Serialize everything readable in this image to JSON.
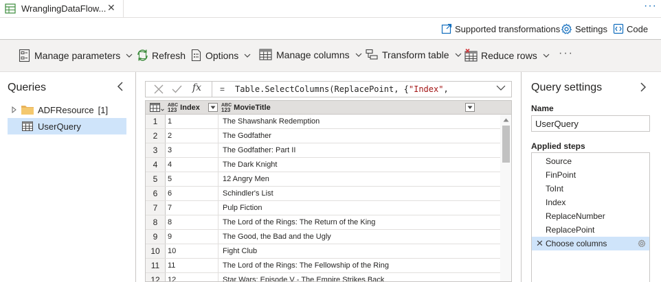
{
  "tab": {
    "title": "WranglingDataFlow...",
    "close": "✕"
  },
  "top_links": {
    "supported": "Supported transformations",
    "settings": "Settings",
    "code": "Code"
  },
  "toolbar": {
    "manage_parameters": "Manage parameters",
    "refresh": "Refresh",
    "options": "Options",
    "manage_columns": "Manage columns",
    "transform_table": "Transform table",
    "reduce_rows": "Reduce rows",
    "more": "···"
  },
  "queries": {
    "title": "Queries",
    "items": [
      {
        "label": "ADFResource",
        "count": "[1]"
      },
      {
        "label": "UserQuery"
      }
    ]
  },
  "formula": {
    "eq": "=",
    "text_prefix": "Table.SelectColumns(ReplacePoint, {",
    "text_string": "\"Index\"",
    "text_suffix": ","
  },
  "grid": {
    "type_badge_top": "ABC",
    "type_badge_bottom": "123",
    "columns": [
      "Index",
      "MovieTitle"
    ],
    "rows": [
      {
        "n": "1",
        "index": "1",
        "title": "The Shawshank Redemption"
      },
      {
        "n": "2",
        "index": "2",
        "title": "The Godfather"
      },
      {
        "n": "3",
        "index": "3",
        "title": "The Godfather: Part II"
      },
      {
        "n": "4",
        "index": "4",
        "title": "The Dark Knight"
      },
      {
        "n": "5",
        "index": "5",
        "title": "12 Angry Men"
      },
      {
        "n": "6",
        "index": "6",
        "title": "Schindler's List"
      },
      {
        "n": "7",
        "index": "7",
        "title": "Pulp Fiction"
      },
      {
        "n": "8",
        "index": "8",
        "title": "The Lord of the Rings: The Return of the King"
      },
      {
        "n": "9",
        "index": "9",
        "title": "The Good, the Bad and the Ugly"
      },
      {
        "n": "10",
        "index": "10",
        "title": "Fight Club"
      },
      {
        "n": "11",
        "index": "11",
        "title": "The Lord of the Rings: The Fellowship of the Ring"
      },
      {
        "n": "12",
        "index": "12",
        "title": "Star Wars: Episode V - The Empire Strikes Back"
      }
    ]
  },
  "query_settings": {
    "title": "Query settings",
    "name_label": "Name",
    "name_value": "UserQuery",
    "steps_label": "Applied steps",
    "steps": [
      "Source",
      "FinPoint",
      "ToInt",
      "Index",
      "ReplaceNumber",
      "ReplacePoint",
      "Choose columns"
    ],
    "selected_step": "Choose columns"
  },
  "colors": {
    "accent": "#0f6cbd",
    "selection": "#cfe4fa",
    "toolbar_bg": "#f3f2f1",
    "folder": "#e8b25a"
  }
}
